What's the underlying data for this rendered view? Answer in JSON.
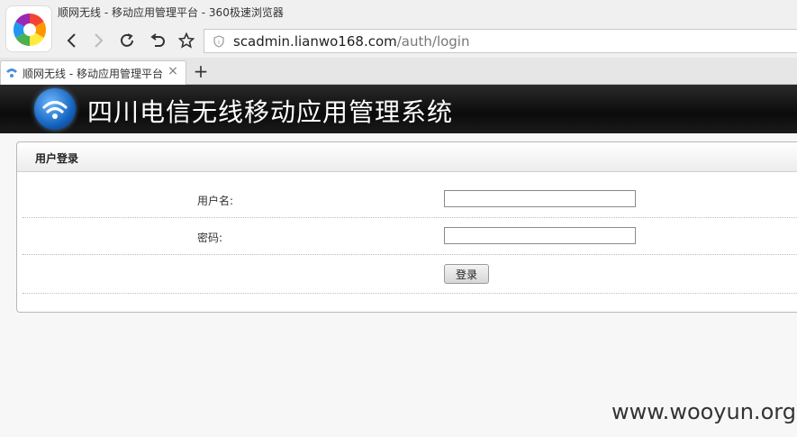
{
  "browser": {
    "window_title": "顺网无线 - 移动应用管理平台 - 360极速浏览器",
    "url_host": "scadmin.lianwo168.com",
    "url_path": "/auth/login",
    "tab_title": "顺网无线 - 移动应用管理平台",
    "tab_close": "×",
    "new_tab": "+"
  },
  "banner": {
    "title": "四川电信无线移动应用管理系统"
  },
  "login": {
    "panel_title": "用户登录",
    "username_label": "用户名:",
    "username_value": "",
    "password_label": "密码:",
    "password_value": "",
    "submit_label": "登录"
  },
  "watermark": "www.wooyun.org"
}
